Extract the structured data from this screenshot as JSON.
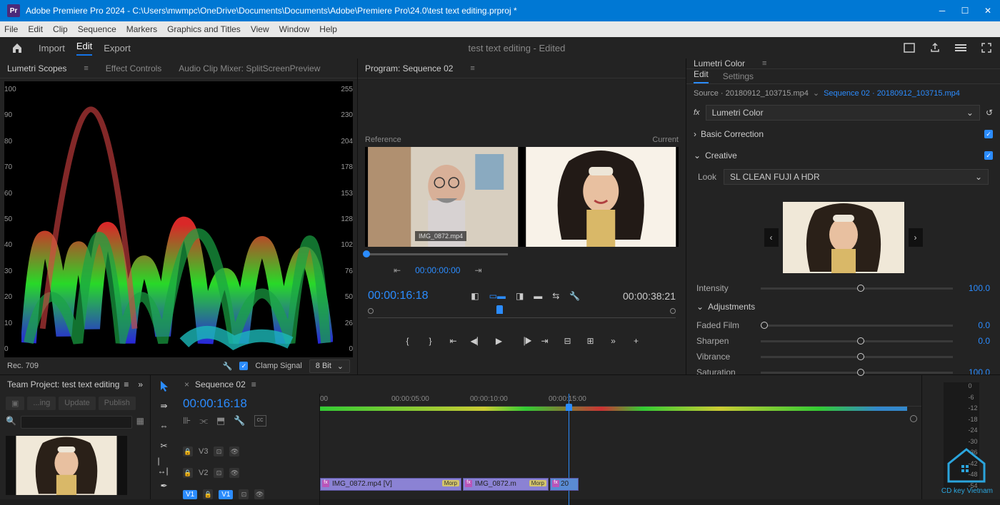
{
  "title": "Adobe Premiere Pro 2024 - C:\\Users\\mwmpc\\OneDrive\\Documents\\Documents\\Adobe\\Premiere Pro\\24.0\\test text editing.prproj *",
  "app_badge": "Pr",
  "menu": [
    "File",
    "Edit",
    "Clip",
    "Sequence",
    "Markers",
    "Graphics and Titles",
    "View",
    "Window",
    "Help"
  ],
  "workspace": {
    "tabs": [
      "Import",
      "Edit",
      "Export"
    ],
    "active": "Edit",
    "doc": "test text editing",
    "doc_suffix": " - Edited"
  },
  "left_tabs": [
    "Lumetri Scopes",
    "Effect Controls",
    "Audio Clip Mixer: SplitScreenPreview"
  ],
  "scopes": {
    "left_axis": [
      100,
      90,
      80,
      70,
      60,
      50,
      40,
      30,
      20,
      10,
      0
    ],
    "right_axis": [
      255,
      230,
      204,
      178,
      153,
      128,
      102,
      76,
      50,
      26,
      0
    ],
    "footer": "Rec. 709",
    "clamp": "Clamp Signal",
    "bit": "8 Bit"
  },
  "program": {
    "title": "Program: Sequence 02",
    "ref": "Reference",
    "cur": "Current",
    "overlay": "IMG_0872.mp4",
    "tc_small": "00:00:00:00",
    "tc_in": "00:00:16:18",
    "tc_out": "00:00:38:21"
  },
  "lumetri": {
    "title": "Lumetri Color",
    "subtabs": [
      "Edit",
      "Settings"
    ],
    "source_a": "Source · 20180912_103715.mp4",
    "source_b": "Sequence 02 · 20180912_103715.mp4",
    "effect": "Lumetri Color",
    "sections": {
      "basic": "Basic Correction",
      "creative": "Creative"
    },
    "look_label": "Look",
    "look": "SL CLEAN FUJI A HDR",
    "intensity": {
      "label": "Intensity",
      "val": "100.0"
    },
    "adjust_head": "Adjustments",
    "faded": {
      "label": "Faded Film",
      "val": "0.0"
    },
    "sharpen": {
      "label": "Sharpen",
      "val": "0.0"
    },
    "vibrance": {
      "label": "Vibrance",
      "val": ""
    },
    "saturation": {
      "label": "Saturation",
      "val": "100.0"
    }
  },
  "project": {
    "title": "Team Project: test text editing",
    "pill1": "...ing",
    "pill2": "Update",
    "pill3": "Publish"
  },
  "timeline": {
    "tab": "Sequence 02",
    "tc": "00:00:16:18",
    "ruler": [
      "00",
      "00:00:05:00",
      "00:00:10:00",
      "00:00:15:00"
    ],
    "tracks": {
      "v3": "V3",
      "v2": "V2",
      "v1": "V1"
    },
    "clip1": "IMG_0872.mp4 [V]",
    "clip2": "IMG_0872.m",
    "mbadge": "Morp",
    "clip3": "20"
  },
  "meter": [
    "0",
    "-6",
    "-12",
    "-18",
    "-24",
    "-30",
    "-36",
    "-42",
    "-48",
    "-54"
  ],
  "watermark": "CD key Vietnam"
}
